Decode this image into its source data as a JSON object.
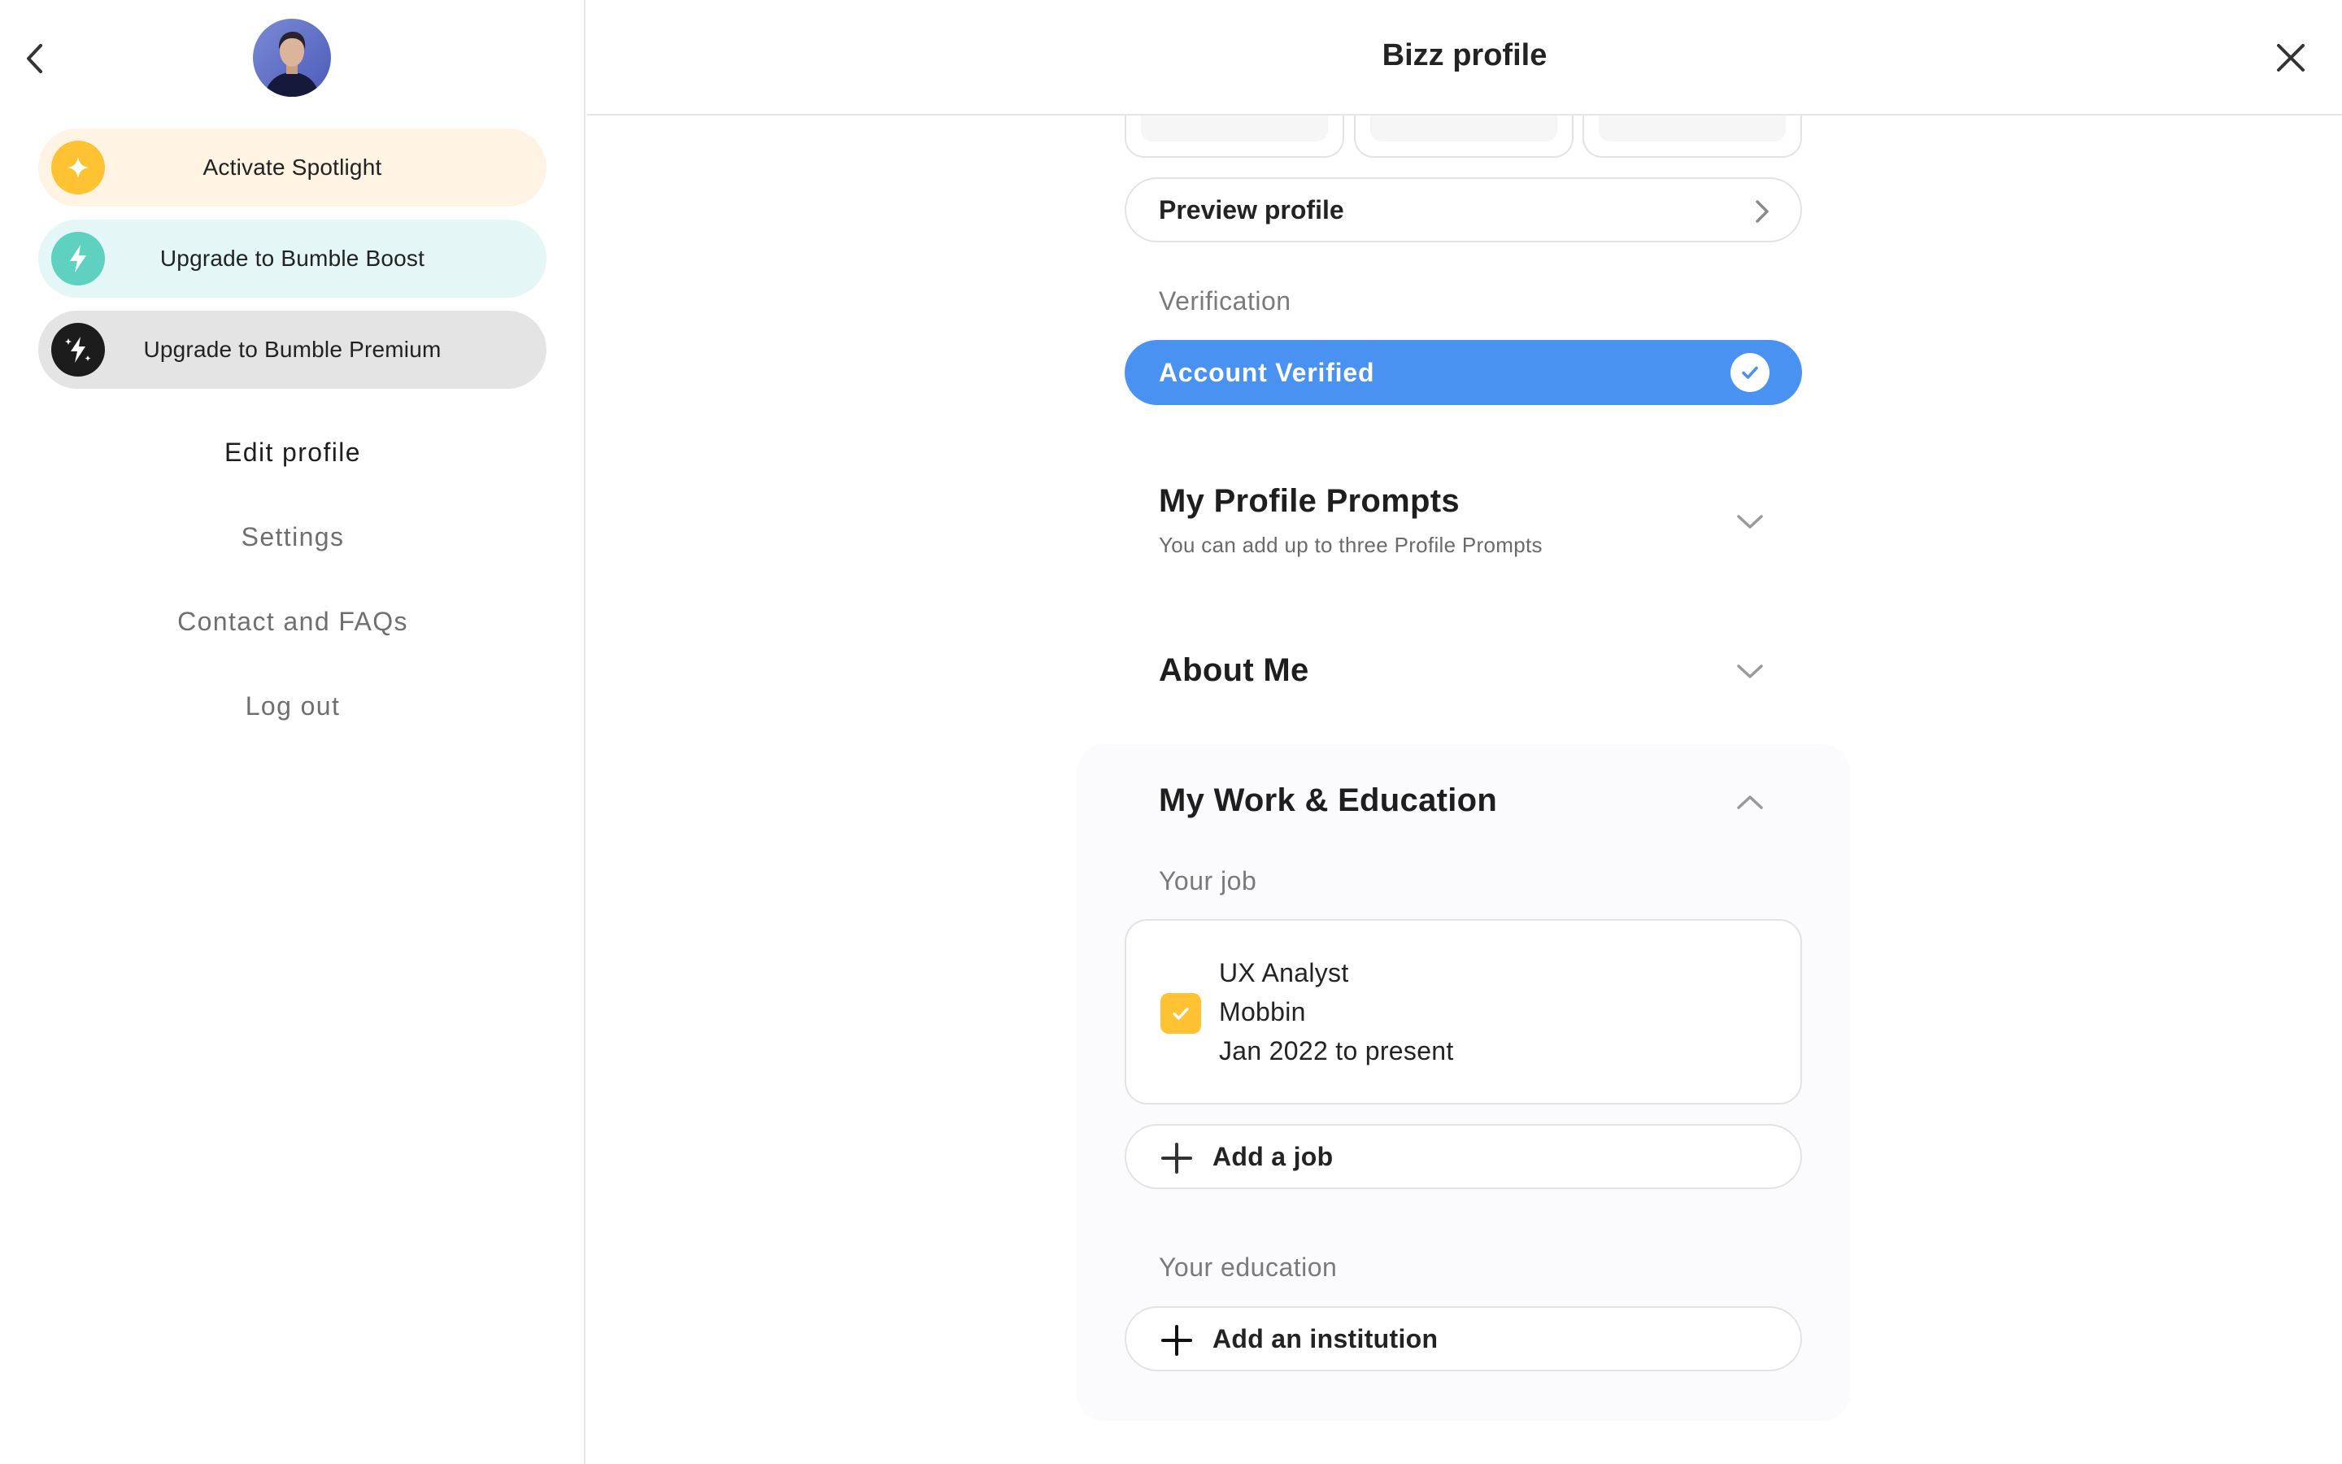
{
  "window": {
    "title": "Bizz profile"
  },
  "sidebar": {
    "promos": [
      {
        "label": "Activate Spotlight",
        "icon": "spotlight-icon",
        "color": "#ffc233"
      },
      {
        "label": "Upgrade to Bumble Boost",
        "icon": "lightning-icon",
        "color": "#5fd1c0"
      },
      {
        "label": "Upgrade to Bumble Premium",
        "icon": "premium-lightning-icon",
        "color": "#1c1c1c"
      }
    ],
    "nav": [
      {
        "label": "Edit profile",
        "active": true
      },
      {
        "label": "Settings",
        "active": false
      },
      {
        "label": "Contact and FAQs",
        "active": false
      },
      {
        "label": "Log out",
        "active": false
      }
    ]
  },
  "main": {
    "preview_label": "Preview profile",
    "verification": {
      "section_label": "Verification",
      "status_label": "Account Verified",
      "color": "#4a92f1"
    },
    "prompts": {
      "title": "My Profile Prompts",
      "subtitle": "You can add up to three Profile Prompts",
      "expanded": false
    },
    "about": {
      "title": "About Me",
      "expanded": false
    },
    "work_education": {
      "title": "My Work & Education",
      "expanded": true,
      "job_label": "Your job",
      "job": {
        "title": "UX Analyst",
        "company": "Mobbin",
        "dates": "Jan 2022 to present",
        "selected": true
      },
      "add_job_label": "Add a job",
      "education_label": "Your education",
      "add_institution_label": "Add an institution"
    }
  }
}
